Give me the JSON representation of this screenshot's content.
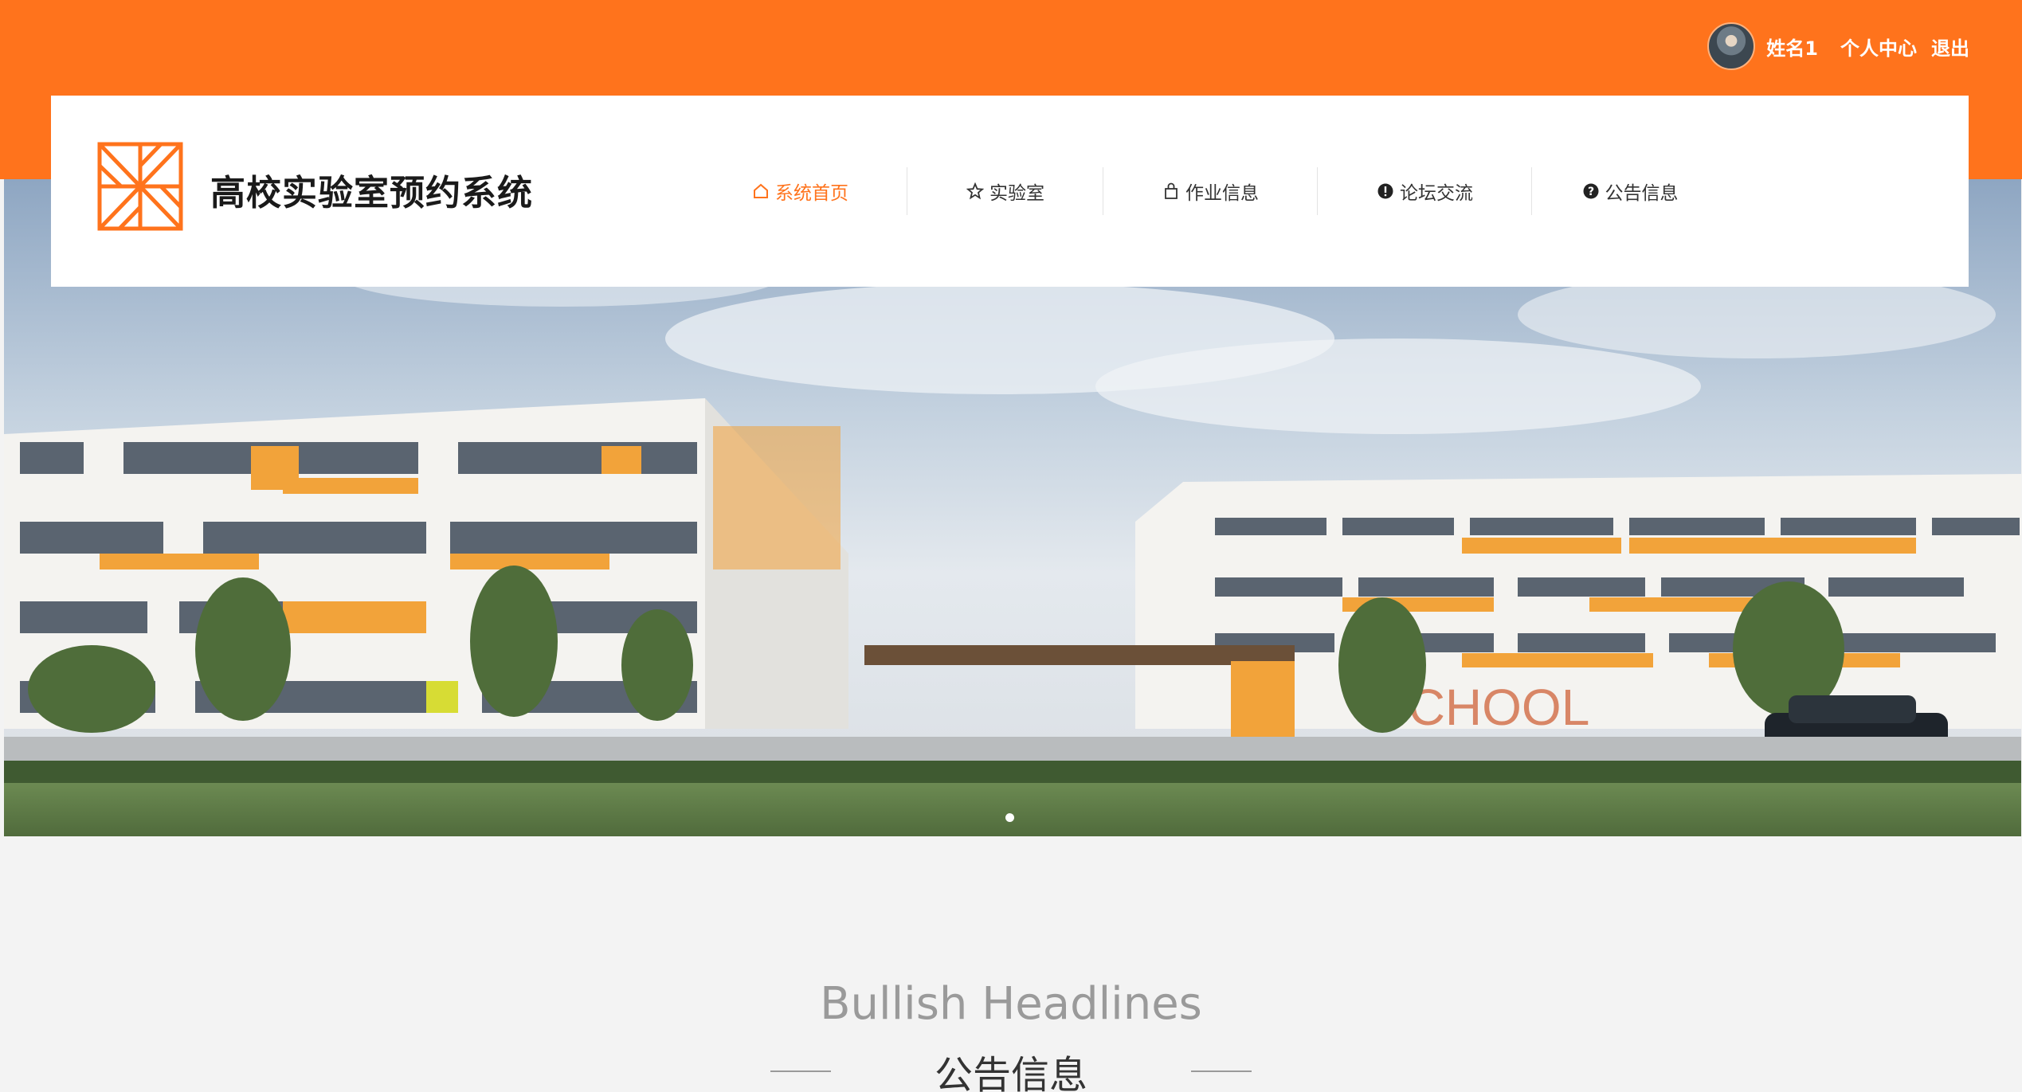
{
  "user": {
    "name": "姓名1",
    "profile_label": "个人中心",
    "logout_label": "退出"
  },
  "site": {
    "title": "高校实验室预约系统"
  },
  "nav": {
    "items": [
      {
        "label": "系统首页",
        "icon": "home-icon",
        "active": true
      },
      {
        "label": "实验室",
        "icon": "star-icon",
        "active": false
      },
      {
        "label": "作业信息",
        "icon": "bag-icon",
        "active": false
      },
      {
        "label": "论坛交流",
        "icon": "exclamation-circle-icon",
        "active": false
      },
      {
        "label": "公告信息",
        "icon": "question-circle-icon",
        "active": false
      }
    ]
  },
  "hero": {
    "sign_text": "SCHOOL"
  },
  "section": {
    "en_title": "Bullish Headlines",
    "cn_title": "公告信息"
  },
  "colors": {
    "accent": "#ff731c",
    "header_bg": "#ffffff",
    "page_bg": "#f3f3f3"
  }
}
